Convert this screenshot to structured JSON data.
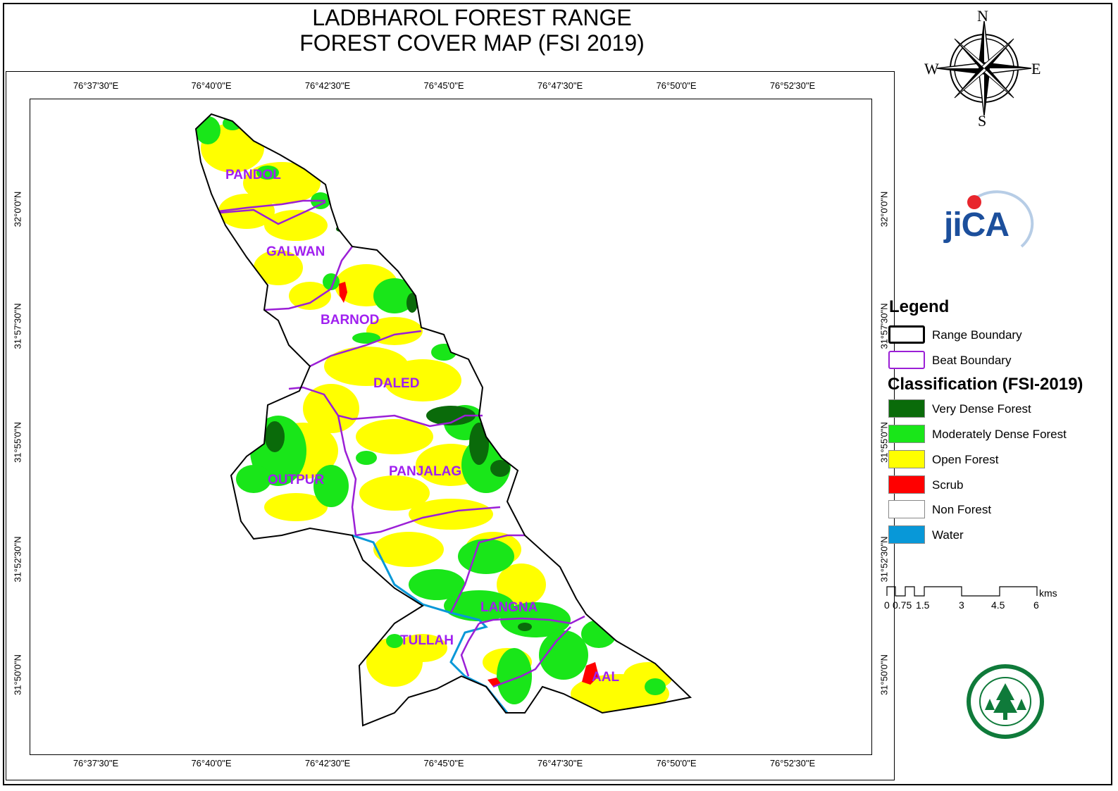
{
  "title": {
    "line1": "LADBHAROL FOREST RANGE",
    "line2": "FOREST COVER MAP (FSI 2019)"
  },
  "graticule": {
    "longitudes": [
      "76°37'30\"E",
      "76°40'0\"E",
      "76°42'30\"E",
      "76°45'0\"E",
      "76°47'30\"E",
      "76°50'0\"E",
      "76°52'30\"E"
    ],
    "latitudes": [
      "32°0'0\"N",
      "31°57'30\"N",
      "31°55'0\"N",
      "31°52'30\"N",
      "31°50'0\"N"
    ]
  },
  "compass": {
    "n": "N",
    "s": "S",
    "e": "E",
    "w": "W"
  },
  "logo_text": "jiCA",
  "beats": [
    "PANDOL",
    "GALWAN",
    "BARNOD",
    "DALED",
    "OUTPUR",
    "PANJALAG",
    "LANGNA",
    "TULLAH",
    "AAL"
  ],
  "legend": {
    "title": "Legend",
    "boundaries": [
      {
        "label": "Range Boundary",
        "color": "#000000"
      },
      {
        "label": "Beat Boundary",
        "color": "#9b1fd6"
      }
    ],
    "classification_title": "Classification (FSI-2019)",
    "classes": [
      {
        "label": "Very Dense Forest",
        "color": "#0a6b0a"
      },
      {
        "label": "Moderately Dense Forest",
        "color": "#19e619"
      },
      {
        "label": "Open Forest",
        "color": "#ffff00"
      },
      {
        "label": "Scrub",
        "color": "#ff0000"
      },
      {
        "label": "Non Forest",
        "color": "#ffffff"
      },
      {
        "label": "Water",
        "color": "#0898d8"
      }
    ]
  },
  "scale_bar": {
    "unit": "kms",
    "labels": [
      "0",
      "0.75",
      "1.5",
      "3",
      "4.5",
      "6"
    ]
  }
}
